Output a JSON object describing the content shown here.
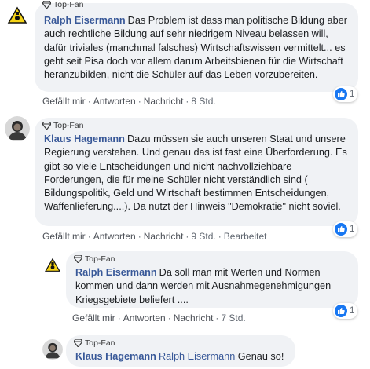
{
  "badge_label": "Top-Fan",
  "comments": [
    {
      "author": "Ralph Eisermann",
      "text": "Das Problem ist dass man politische Bildung aber auch rechtliche Bildung auf sehr niedrigem Niveau belassen will, dafür triviales (manchmal falsches) Wirtschaftswissen vermittelt... es geht seit Pisa doch vor allem darum Arbeitsbienen für die Wirtschaft heranzubilden, nicht die Schüler auf das Leben vorzubereiten.",
      "like": "Gefällt mir",
      "reply": "Antworten",
      "message": "Nachricht",
      "time": "8 Std.",
      "reactions": "1"
    },
    {
      "author": "Klaus Hagemann",
      "text": "Dazu müssen sie auch unseren Staat und unsere Regierung verstehen. Und genau das ist fast eine Überforderung. Es gibt so viele Entscheidungen und nicht nachvollziehbare Forderungen, die für meine Schüler nicht verständlich sind ( Bildungspolitik, Geld und Wirtschaft bestimmen Entscheidungen, Waffenlieferung....). Da nutzt der Hinweis \"Demokratie\" nicht soviel.",
      "like": "Gefällt mir",
      "reply": "Antworten",
      "message": "Nachricht",
      "time": "9 Std.",
      "edited": "Bearbeitet",
      "reactions": "1"
    },
    {
      "author": "Ralph Eisermann",
      "text": "Da soll man mit Werten und Normen kommen und dann werden mit Ausnahmegenehmigungen Kriegsgebiete beliefert ....",
      "like": "Gefällt mir",
      "reply": "Antworten",
      "message": "Nachricht",
      "time": "7 Std.",
      "reactions": "1"
    },
    {
      "author": "Klaus Hagemann",
      "mention": "Ralph Eisermann",
      "text": "Genau so!"
    }
  ],
  "colors": {
    "author": "#385898",
    "bubble": "#f0f2f5",
    "like_blue": "#1877f2",
    "meta": "#606770"
  }
}
